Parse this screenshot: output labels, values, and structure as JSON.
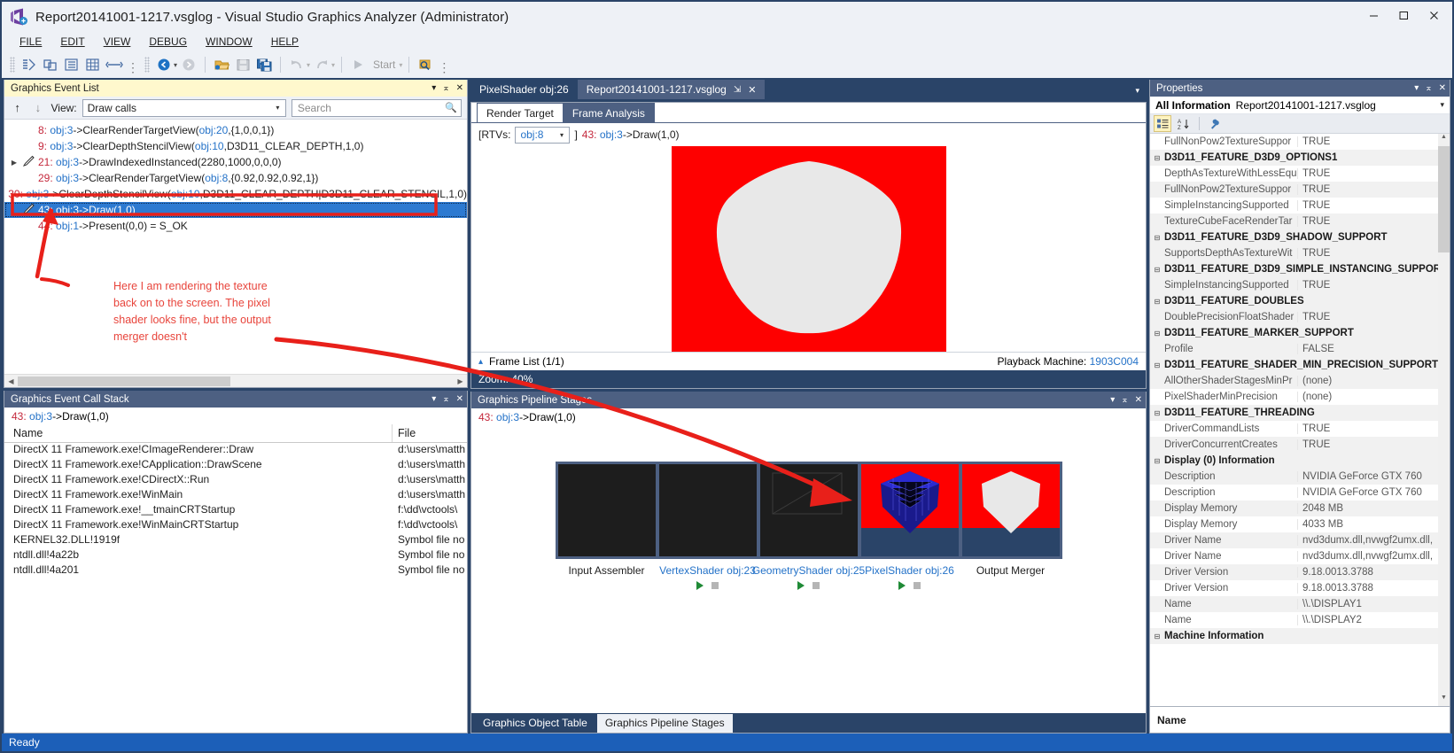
{
  "window": {
    "title": "Report20141001-1217.vsglog - Visual Studio Graphics Analyzer (Administrator)",
    "minimize": "–",
    "maximize": "☐",
    "close": "✕"
  },
  "menu": [
    "FILE",
    "EDIT",
    "VIEW",
    "DEBUG",
    "WINDOW",
    "HELP"
  ],
  "toolbar": {
    "start_label": "Start",
    "caret": "▾",
    "overflow": "∶"
  },
  "event_list": {
    "panel_title": "Graphics Event List",
    "view_label": "View:",
    "view_value": "Draw calls",
    "search_placeholder": "Search",
    "up_arrow": "↑",
    "down_arrow": "↓",
    "rows": [
      {
        "num": "8:",
        "obj": "obj:3",
        "rest": "->ClearRenderTargetView(",
        "obj2": "obj:20",
        "rest2": ",{1,0,0,1})",
        "expander": false,
        "icon": false,
        "selected": false
      },
      {
        "num": "9:",
        "obj": "obj:3",
        "rest": "->ClearDepthStencilView(",
        "obj2": "obj:10",
        "rest2": ",D3D11_CLEAR_DEPTH,1,0)",
        "expander": false,
        "icon": false,
        "selected": false
      },
      {
        "num": "21:",
        "obj": "obj:3",
        "rest": "->DrawIndexedInstanced(2280,1000,0,0,0)",
        "obj2": "",
        "rest2": "",
        "expander": true,
        "icon": true,
        "selected": false
      },
      {
        "num": "29:",
        "obj": "obj:3",
        "rest": "->ClearRenderTargetView(",
        "obj2": "obj:8",
        "rest2": ",{0.92,0.92,0.92,1})",
        "expander": false,
        "icon": false,
        "selected": false
      },
      {
        "num": "30:",
        "obj": "obj:3",
        "rest": "->ClearDepthStencilView(",
        "obj2": "obj:10",
        "rest2": ",D3D11_CLEAR_DEPTH|D3D11_CLEAR_STENCIL,1,0)",
        "expander": false,
        "icon": false,
        "selected": false
      },
      {
        "num": "43:",
        "obj": "obj:3",
        "rest": "->Draw(1,0)",
        "obj2": "",
        "rest2": "",
        "expander": false,
        "icon": true,
        "selected": true
      },
      {
        "num": "44:",
        "obj": "obj:1",
        "rest": "->Present(0,0) = S_OK",
        "obj2": "",
        "rest2": "",
        "expander": false,
        "icon": false,
        "selected": false
      }
    ]
  },
  "annotation": {
    "lines": [
      "Here I am rendering the texture",
      "back on to the screen. The pixel",
      "shader looks fine, but the output",
      "merger doesn't"
    ],
    "color": "#e8453c"
  },
  "call_stack": {
    "panel_title": "Graphics Event Call Stack",
    "event_num": "43:",
    "event_obj": "obj:3",
    "event_rest": "->Draw(1,0)",
    "columns": [
      "Name",
      "File"
    ],
    "rows": [
      {
        "name": "DirectX 11 Framework.exe!CImageRenderer::Draw",
        "file": "d:\\users\\matth"
      },
      {
        "name": "DirectX 11 Framework.exe!CApplication::DrawScene",
        "file": "d:\\users\\matth"
      },
      {
        "name": "DirectX 11 Framework.exe!CDirectX::Run",
        "file": "d:\\users\\matth"
      },
      {
        "name": "DirectX 11 Framework.exe!WinMain",
        "file": "d:\\users\\matth"
      },
      {
        "name": "DirectX 11 Framework.exe!__tmainCRTStartup",
        "file": "f:\\dd\\vctools\\"
      },
      {
        "name": "DirectX 11 Framework.exe!WinMainCRTStartup",
        "file": "f:\\dd\\vctools\\"
      },
      {
        "name": "KERNEL32.DLL!1919f",
        "file": "Symbol file no"
      },
      {
        "name": "ntdll.dll!4a22b",
        "file": "Symbol file no"
      },
      {
        "name": "ntdll.dll!4a201",
        "file": "Symbol file no"
      }
    ]
  },
  "document": {
    "tabs": [
      {
        "label": "PixelShader obj:26",
        "active": false,
        "pin": "",
        "close": ""
      },
      {
        "label": "Report20141001-1217.vsglog",
        "active": true,
        "pin": "⇲",
        "close": "✕"
      }
    ],
    "strip_caret": "▾",
    "inner_tabs": [
      {
        "label": "Render Target",
        "active": true
      },
      {
        "label": "Frame Analysis",
        "active": false
      }
    ],
    "rtv_prefix": "[RTVs:",
    "rtv_value": "obj:8",
    "rtv_suffix": "]",
    "rtv_event_num": "43:",
    "rtv_event_obj": "obj:3",
    "rtv_event_rest": "->Draw(1,0)",
    "frame_list_label": "Frame List (1/1)",
    "frame_list_caret": "▴",
    "playback_label": "Playback Machine:",
    "playback_machine": "1903C004",
    "zoom_label": "Zoom: 40%"
  },
  "pipeline": {
    "panel_title": "Graphics Pipeline Stages",
    "event_num": "43:",
    "event_obj": "obj:3",
    "event_rest": "->Draw(1,0)",
    "stages": [
      {
        "label": "Input Assembler",
        "link": false,
        "controls": false,
        "thumb": "dark"
      },
      {
        "label": "VertexShader obj:23",
        "link": true,
        "controls": true,
        "thumb": "dark"
      },
      {
        "label": "GeometryShader obj:25",
        "link": true,
        "controls": true,
        "thumb": "wire"
      },
      {
        "label": "PixelShader obj:26",
        "link": true,
        "controls": true,
        "thumb": "cube-blue"
      },
      {
        "label": "Output Merger",
        "link": false,
        "controls": false,
        "thumb": "cube-white"
      }
    ],
    "tabs": [
      {
        "label": "Graphics Object Table",
        "active": false
      },
      {
        "label": "Graphics Pipeline Stages",
        "active": true
      }
    ]
  },
  "properties": {
    "panel_title": "Properties",
    "all_info_label": "All Information",
    "all_info_value": "Report20141001-1217.vsglog",
    "footer_label": "Name",
    "rows": [
      {
        "type": "prop",
        "name": "FullNonPow2TextureSuppor",
        "value": "TRUE"
      },
      {
        "type": "group",
        "name": "D3D11_FEATURE_D3D9_OPTIONS1"
      },
      {
        "type": "prop",
        "name": "DepthAsTextureWithLessEqu",
        "value": "TRUE"
      },
      {
        "type": "prop",
        "name": "FullNonPow2TextureSuppor",
        "value": "TRUE"
      },
      {
        "type": "prop",
        "name": "SimpleInstancingSupported",
        "value": "TRUE"
      },
      {
        "type": "prop",
        "name": "TextureCubeFaceRenderTar",
        "value": "TRUE"
      },
      {
        "type": "group",
        "name": "D3D11_FEATURE_D3D9_SHADOW_SUPPORT"
      },
      {
        "type": "prop",
        "name": "SupportsDepthAsTextureWit",
        "value": "TRUE"
      },
      {
        "type": "group",
        "name": "D3D11_FEATURE_D3D9_SIMPLE_INSTANCING_SUPPORT"
      },
      {
        "type": "prop",
        "name": "SimpleInstancingSupported",
        "value": "TRUE"
      },
      {
        "type": "group",
        "name": "D3D11_FEATURE_DOUBLES"
      },
      {
        "type": "prop",
        "name": "DoublePrecisionFloatShader",
        "value": "TRUE"
      },
      {
        "type": "group",
        "name": "D3D11_FEATURE_MARKER_SUPPORT"
      },
      {
        "type": "prop",
        "name": "Profile",
        "value": "FALSE"
      },
      {
        "type": "group",
        "name": "D3D11_FEATURE_SHADER_MIN_PRECISION_SUPPORT"
      },
      {
        "type": "prop",
        "name": "AllOtherShaderStagesMinPr",
        "value": "(none)"
      },
      {
        "type": "prop",
        "name": "PixelShaderMinPrecision",
        "value": "(none)"
      },
      {
        "type": "group",
        "name": "D3D11_FEATURE_THREADING"
      },
      {
        "type": "prop",
        "name": "DriverCommandLists",
        "value": "TRUE"
      },
      {
        "type": "prop",
        "name": "DriverConcurrentCreates",
        "value": "TRUE"
      },
      {
        "type": "group",
        "name": "Display (0) Information"
      },
      {
        "type": "prop",
        "name": "Description",
        "value": "NVIDIA GeForce GTX 760"
      },
      {
        "type": "prop",
        "name": "Description",
        "value": "NVIDIA GeForce GTX 760"
      },
      {
        "type": "prop",
        "name": "Display Memory",
        "value": "2048 MB"
      },
      {
        "type": "prop",
        "name": "Display Memory",
        "value": "4033 MB"
      },
      {
        "type": "prop",
        "name": "Driver Name",
        "value": "nvd3dumx.dll,nvwgf2umx.dll,"
      },
      {
        "type": "prop",
        "name": "Driver Name",
        "value": "nvd3dumx.dll,nvwgf2umx.dll,"
      },
      {
        "type": "prop",
        "name": "Driver Version",
        "value": "9.18.0013.3788"
      },
      {
        "type": "prop",
        "name": "Driver Version",
        "value": "9.18.0013.3788"
      },
      {
        "type": "prop",
        "name": "Name",
        "value": "\\\\.\\DISPLAY1"
      },
      {
        "type": "prop",
        "name": "Name",
        "value": "\\\\.\\DISPLAY2"
      },
      {
        "type": "group",
        "name": "Machine Information"
      }
    ]
  },
  "statusbar": {
    "text": "Ready"
  }
}
